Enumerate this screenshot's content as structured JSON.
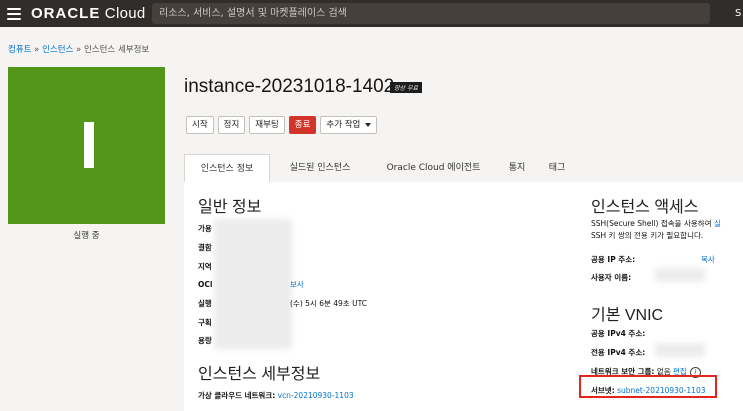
{
  "header": {
    "brand_bold": "ORACLE",
    "brand_light": " Cloud",
    "search_placeholder": "리소스, 서비스, 설명서 및 마켓플레이스 검색",
    "right_text": "S"
  },
  "breadcrumb": {
    "item1": "컴퓨트",
    "item2": "인스턴스",
    "current": "인스턴스 세부정보",
    "sep": " » "
  },
  "status": {
    "label": "실행 중",
    "color": "#539619"
  },
  "instance": {
    "title": "instance-20231018-1402",
    "tag": "항상 무료"
  },
  "actions": {
    "start": "시작",
    "stop": "정지",
    "reboot": "재부팅",
    "terminate": "종료",
    "more": "추가 작업"
  },
  "tabs": [
    "인스턴스 정보",
    "실드된 인스턴스",
    "Oracle Cloud 에이전트",
    "통지",
    "태그"
  ],
  "general": {
    "heading": "일반 정보",
    "labels": [
      "가용",
      "결함",
      "지역",
      "OCI",
      "실행",
      "구획",
      "용량"
    ],
    "ocid_link": "보사",
    "launched_value": "(수) 5시 6분 49초 UTC"
  },
  "details": {
    "heading": "인스턴스 세부정보",
    "vcn_label": "가상 클라우드 네트워크:",
    "vcn_value": "vcn-20210930-1103"
  },
  "access": {
    "heading": "인스턴스 액세스",
    "desc1": "SSH(Secure Shell) 접속을 사용하여",
    "desc1_link": "실",
    "desc2": "SSH 키 쌍의 전용 키가 필요합니다.",
    "public_ip_label": "공용 IP 주소:",
    "copy": "복사",
    "username_label": "사용자 이름:"
  },
  "vnic": {
    "heading": "기본 VNIC",
    "public_ipv4_label": "공용 IPv4 주소:",
    "private_ipv4_label": "전용 IPv4 주소:",
    "nsg_label": "네트워크 보안 그룹:",
    "nsg_value": "없음",
    "edit": "편집",
    "info": "i",
    "subnet_label": "서브넷:",
    "subnet_value": "subnet-20210930-1103"
  },
  "colors": {
    "accent": "#0572ce",
    "danger": "#d2342a",
    "highlight": "#e3261c"
  }
}
